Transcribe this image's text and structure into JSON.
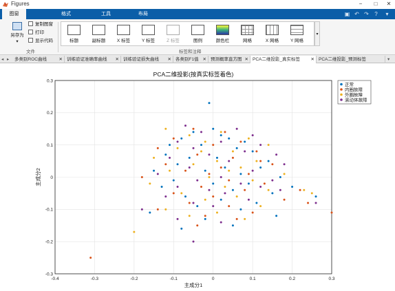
{
  "window": {
    "title": "Figures"
  },
  "ribbon_tabs": [
    {
      "label": "图窗",
      "active": true
    },
    {
      "label": "格式",
      "active": false
    },
    {
      "label": "工具",
      "active": false
    },
    {
      "label": "布局",
      "active": false
    }
  ],
  "file_group": {
    "save_label": "另存为",
    "copy_label": "复制图窗",
    "print_label": "打印",
    "show_code_label": "显示代码",
    "group_label": "文件"
  },
  "labels_group": {
    "items": [
      {
        "label": "标题",
        "enabled": true
      },
      {
        "label": "副标题",
        "enabled": true
      },
      {
        "label": "X 标签",
        "enabled": true
      },
      {
        "label": "Y 标签",
        "enabled": true
      },
      {
        "label": "Z 标签",
        "enabled": false
      },
      {
        "label": "图例",
        "enabled": true
      },
      {
        "label": "颜色栏",
        "enabled": true
      },
      {
        "label": "网格",
        "enabled": true
      },
      {
        "label": "X 网格",
        "enabled": true
      },
      {
        "label": "Y 网格",
        "enabled": true
      }
    ],
    "group_label": "标签和注释"
  },
  "doc_tabs": [
    {
      "label": "多类别ROC曲线",
      "active": false
    },
    {
      "label": "训练验证准确率曲线",
      "active": false
    },
    {
      "label": "训练验证损失曲线",
      "active": false
    },
    {
      "label": "各类别F1值",
      "active": false
    },
    {
      "label": "预测概率直方图",
      "active": false
    },
    {
      "label": "PCA二维投影_真实标签",
      "active": true
    },
    {
      "label": "PCA二维投影_预测标签",
      "active": false
    }
  ],
  "colors": {
    "ribbon_blue": "#0b5ea8",
    "series": [
      "#0072BD",
      "#D95319",
      "#EDB120",
      "#7E2F8E"
    ]
  },
  "chart_data": {
    "type": "scatter",
    "title": "PCA二维投影(按真实标签着色)",
    "xlabel": "主成分1",
    "ylabel": "主成分2",
    "xlim": [
      -0.4,
      0.3
    ],
    "ylim": [
      -0.3,
      0.3
    ],
    "xticks": [
      "-0.4",
      "-0.3",
      "-0.2",
      "-0.1",
      "0",
      "0.1",
      "0.2",
      "0.3"
    ],
    "yticks": [
      "-0.3",
      "-0.2",
      "-0.1",
      "0",
      "0.1",
      "0.2",
      "0.3"
    ],
    "grid": true,
    "legend_position": "top-right",
    "series": [
      {
        "name": "正常",
        "points": [
          [
            -0.01,
            0.23
          ],
          [
            0.0,
            0.15
          ],
          [
            -0.05,
            0.14
          ],
          [
            0.02,
            0.13
          ],
          [
            -0.08,
            0.12
          ],
          [
            0.04,
            0.12
          ],
          [
            0.08,
            0.11
          ],
          [
            -0.03,
            0.1
          ],
          [
            0.06,
            0.09
          ],
          [
            0.1,
            0.08
          ],
          [
            -0.12,
            0.07
          ],
          [
            -0.06,
            0.06
          ],
          [
            0.01,
            0.06
          ],
          [
            0.14,
            0.05
          ],
          [
            -0.09,
            0.04
          ],
          [
            0.03,
            0.03
          ],
          [
            0.12,
            0.03
          ],
          [
            -0.15,
            0.02
          ],
          [
            -0.02,
            0.02
          ],
          [
            0.07,
            0.01
          ],
          [
            0.17,
            0.0
          ],
          [
            -0.1,
            -0.01
          ],
          [
            0.0,
            -0.02
          ],
          [
            0.09,
            -0.02
          ],
          [
            -0.13,
            -0.03
          ],
          [
            0.05,
            -0.04
          ],
          [
            0.15,
            -0.05
          ],
          [
            -0.07,
            -0.06
          ],
          [
            0.02,
            -0.07
          ],
          [
            0.11,
            -0.08
          ],
          [
            -0.04,
            -0.09
          ],
          [
            0.07,
            -0.1
          ],
          [
            -0.16,
            -0.11
          ],
          [
            0.16,
            -0.12
          ],
          [
            -0.02,
            -0.13
          ],
          [
            0.05,
            -0.15
          ],
          [
            -0.08,
            -0.16
          ],
          [
            0.26,
            -0.06
          ],
          [
            0.2,
            -0.03
          ],
          [
            -0.11,
            0.1
          ]
        ]
      },
      {
        "name": "内圈故障",
        "points": [
          [
            -0.05,
            0.15
          ],
          [
            0.03,
            0.14
          ],
          [
            -0.1,
            0.12
          ],
          [
            0.07,
            0.11
          ],
          [
            0.0,
            0.1
          ],
          [
            -0.14,
            0.09
          ],
          [
            0.11,
            0.08
          ],
          [
            -0.04,
            0.07
          ],
          [
            0.05,
            0.06
          ],
          [
            -0.12,
            0.04
          ],
          [
            0.15,
            0.04
          ],
          [
            0.02,
            0.03
          ],
          [
            -0.07,
            0.02
          ],
          [
            0.09,
            0.01
          ],
          [
            -0.18,
            0.0
          ],
          [
            0.04,
            -0.01
          ],
          [
            0.13,
            -0.02
          ],
          [
            -0.03,
            -0.03
          ],
          [
            0.08,
            -0.04
          ],
          [
            -0.1,
            -0.05
          ],
          [
            0.0,
            -0.06
          ],
          [
            0.18,
            -0.07
          ],
          [
            -0.06,
            -0.08
          ],
          [
            0.04,
            -0.09
          ],
          [
            -0.14,
            -0.1
          ],
          [
            0.1,
            -0.11
          ],
          [
            -0.02,
            -0.12
          ],
          [
            0.06,
            -0.13
          ],
          [
            -0.04,
            -0.15
          ],
          [
            0.3,
            -0.11
          ],
          [
            -0.31,
            -0.25
          ],
          [
            0.24,
            -0.08
          ],
          [
            0.22,
            -0.04
          ],
          [
            0.12,
            0.05
          ],
          [
            -0.01,
            0.01
          ]
        ]
      },
      {
        "name": "外圈故障",
        "points": [
          [
            -0.12,
            0.15
          ],
          [
            0.02,
            0.14
          ],
          [
            -0.06,
            0.13
          ],
          [
            0.09,
            0.12
          ],
          [
            -0.02,
            0.11
          ],
          [
            0.14,
            0.1
          ],
          [
            -0.09,
            0.09
          ],
          [
            0.05,
            0.08
          ],
          [
            -0.15,
            0.06
          ],
          [
            0.01,
            0.05
          ],
          [
            0.11,
            0.05
          ],
          [
            -0.05,
            0.04
          ],
          [
            0.07,
            0.03
          ],
          [
            -0.11,
            0.02
          ],
          [
            0.18,
            0.01
          ],
          [
            -0.01,
            0.0
          ],
          [
            0.1,
            -0.01
          ],
          [
            -0.16,
            -0.02
          ],
          [
            0.03,
            -0.03
          ],
          [
            0.14,
            -0.04
          ],
          [
            -0.08,
            -0.05
          ],
          [
            0.06,
            -0.06
          ],
          [
            -0.02,
            -0.07
          ],
          [
            0.12,
            -0.09
          ],
          [
            -0.12,
            -0.1
          ],
          [
            0.01,
            -0.11
          ],
          [
            -0.06,
            -0.12
          ],
          [
            0.08,
            -0.13
          ],
          [
            -0.2,
            -0.17
          ],
          [
            0.23,
            -0.04
          ],
          [
            0.25,
            -0.05
          ],
          [
            -0.03,
            0.08
          ],
          [
            0.04,
            0.02
          ]
        ]
      },
      {
        "name": "滚动体故障",
        "points": [
          [
            -0.07,
            0.16
          ],
          [
            0.06,
            0.15
          ],
          [
            -0.03,
            0.14
          ],
          [
            0.1,
            0.13
          ],
          [
            -0.09,
            0.11
          ],
          [
            0.02,
            0.11
          ],
          [
            0.12,
            0.1
          ],
          [
            -0.05,
            0.09
          ],
          [
            0.08,
            0.08
          ],
          [
            -0.01,
            0.07
          ],
          [
            0.16,
            0.07
          ],
          [
            -0.11,
            0.06
          ],
          [
            0.04,
            0.05
          ],
          [
            -0.06,
            0.03
          ],
          [
            0.1,
            0.02
          ],
          [
            -0.14,
            0.01
          ],
          [
            0.02,
            0.0
          ],
          [
            0.15,
            -0.01
          ],
          [
            -0.04,
            -0.01
          ],
          [
            0.07,
            -0.02
          ],
          [
            -0.09,
            -0.03
          ],
          [
            0.12,
            -0.03
          ],
          [
            -0.01,
            -0.04
          ],
          [
            0.17,
            -0.04
          ],
          [
            -0.12,
            -0.06
          ],
          [
            0.03,
            -0.05
          ],
          [
            0.09,
            -0.07
          ],
          [
            -0.05,
            -0.08
          ],
          [
            0.0,
            -0.09
          ],
          [
            -0.09,
            -0.13
          ],
          [
            0.02,
            -0.14
          ],
          [
            -0.05,
            -0.2
          ],
          [
            -0.18,
            -0.1
          ],
          [
            0.26,
            -0.08
          ],
          [
            0.18,
            0.04
          ]
        ]
      }
    ]
  }
}
